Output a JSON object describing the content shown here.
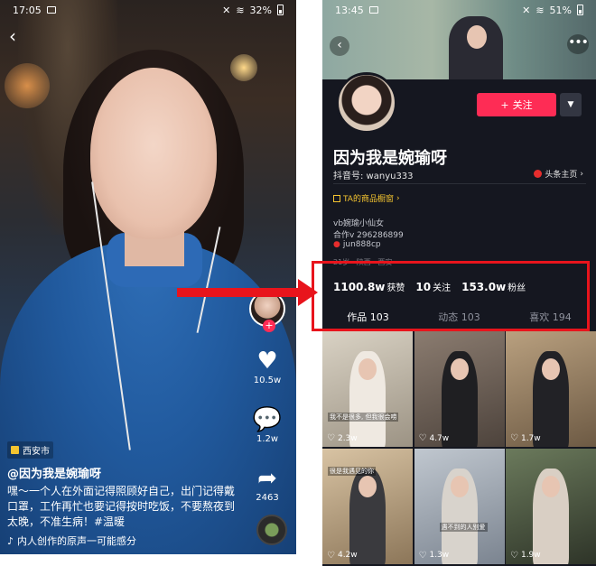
{
  "left": {
    "status": {
      "time": "17:05",
      "battery": "32%"
    },
    "location": "西安市",
    "author": "@因为我是婉瑜呀",
    "caption": "嘿～一个人在外面记得照顾好自己，出门记得戴口罩，工作再忙也要记得按时吃饭，不要熬夜到太晚，不准生病！#温暖",
    "music": "内人创作的原声一可能感分",
    "likes": "10.5w",
    "comments": "1.2w",
    "shares": "2463"
  },
  "right": {
    "status": {
      "time": "13:45",
      "battery": "51%"
    },
    "follow_label": "关注",
    "name": "因为我是婉瑜呀",
    "handle": "抖音号: wanyu333",
    "toutiao": "头条主页",
    "shop": "TA的商品橱窗",
    "bio": [
      "vb婉瑜小仙女",
      "合作v 296286899",
      "jun888cp"
    ],
    "bio_tag": "21岁 · 陕西 · 西安",
    "stats": {
      "likes_value": "1100.8w",
      "likes_label": "获赞",
      "following_value": "10",
      "following_label": "关注",
      "followers_value": "153.0w",
      "followers_label": "粉丝"
    },
    "tabs": [
      "作品 103",
      "动态 103",
      "喜欢 194"
    ],
    "videos": [
      {
        "likes": "2.3w",
        "caption": "我不是很多, 但我很会唠",
        "color": "#c7c0b4"
      },
      {
        "likes": "4.7w",
        "caption": "",
        "color": "#7a6a60"
      },
      {
        "likes": "1.7w",
        "caption": "",
        "color": "#9a8770"
      },
      {
        "likes": "4.2w",
        "caption": "很是我遇见的你",
        "color": "#b7a58d"
      },
      {
        "likes": "1.3w",
        "caption": "遇不到的人别爱",
        "color": "#9aa3ad"
      },
      {
        "likes": "1.9w",
        "caption": "",
        "color": "#4a5346"
      }
    ]
  },
  "colors": {
    "accent": "#fe2c55",
    "highlight": "#e8141c",
    "gold": "#f4c430"
  }
}
